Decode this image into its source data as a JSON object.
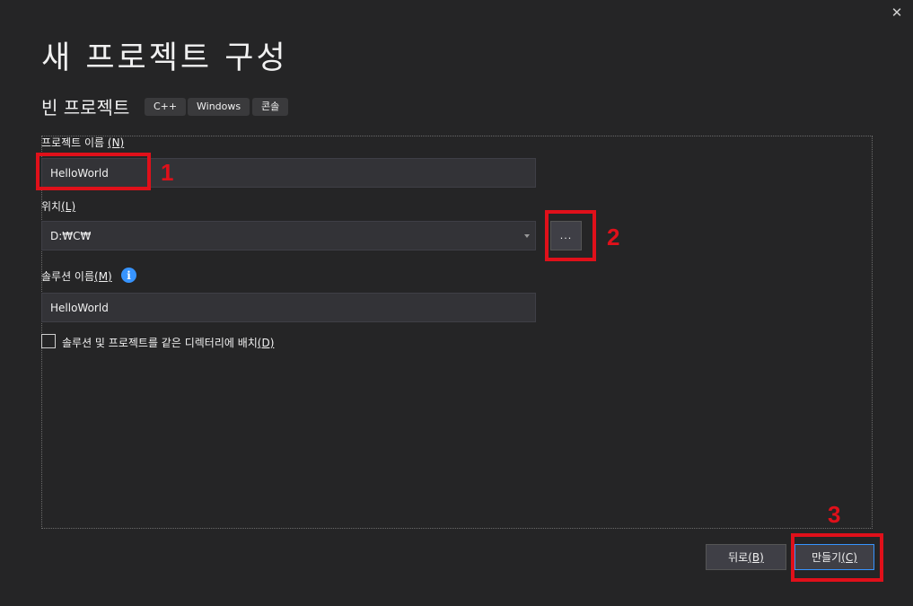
{
  "window": {
    "close_glyph": "✕"
  },
  "header": {
    "title": "새 프로젝트 구성",
    "template_name": "빈 프로젝트",
    "tags": [
      "C++",
      "Windows",
      "콘솔"
    ]
  },
  "form": {
    "project_name": {
      "label": "프로젝트 이름",
      "mnemonic": "(N)",
      "value": "HelloWorld"
    },
    "location": {
      "label": "위치",
      "mnemonic": "(L)",
      "value": "D:₩C₩",
      "browse_label": "..."
    },
    "solution_name": {
      "label": "솔루션 이름",
      "mnemonic": "(M)",
      "info_glyph": "i",
      "value": "HelloWorld"
    },
    "same_dir": {
      "label": "솔루션 및 프로젝트를 같은 디렉터리에 배치",
      "mnemonic": "(D)",
      "checked": false
    }
  },
  "footer": {
    "back": {
      "label": "뒤로",
      "mnemonic": "(B)"
    },
    "create": {
      "label": "만들기",
      "mnemonic": "(C)"
    }
  },
  "annotations": [
    "1",
    "2",
    "3"
  ],
  "colors": {
    "background": "#252526",
    "input": "#333337",
    "accent": "#3794ff",
    "highlight": "#e0101a"
  },
  "icons": {
    "close": "close-icon",
    "info": "info-icon",
    "dropdown": "chevron-down-icon"
  }
}
